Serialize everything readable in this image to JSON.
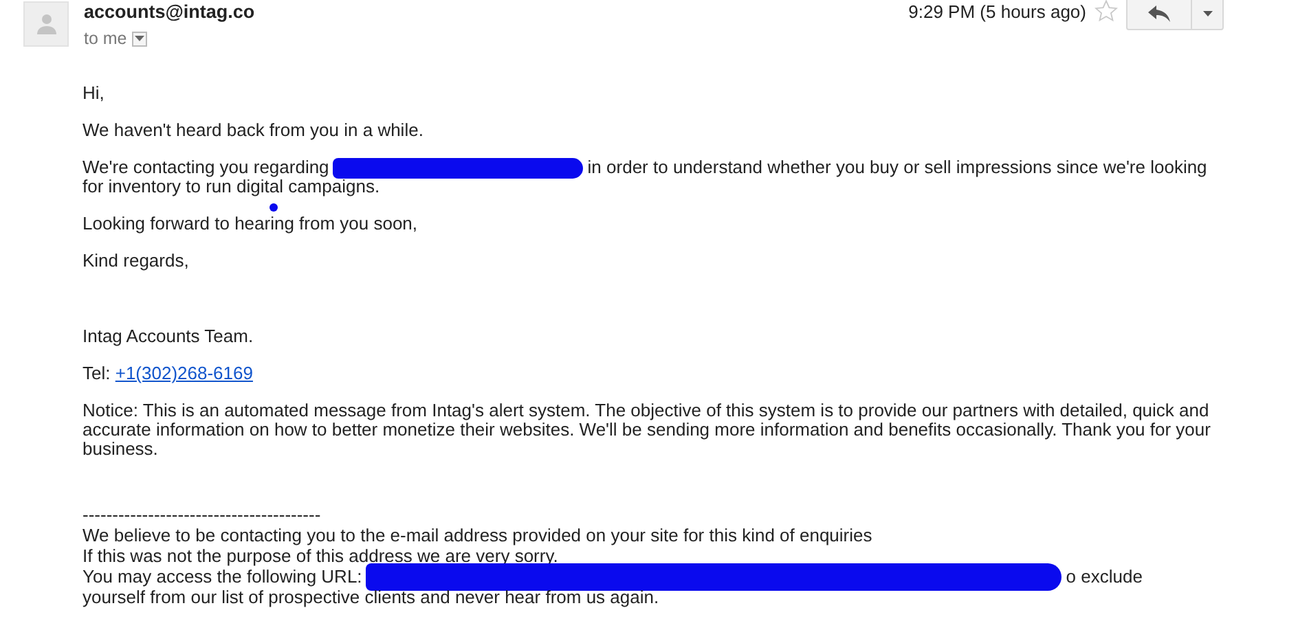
{
  "header": {
    "sender": "accounts@intag.co",
    "recipient": "to me",
    "time": "9:29 PM (5 hours ago)",
    "starred": false
  },
  "greeting": "Hi,",
  "paragraphs": [
    {
      "kind": "text",
      "text": "We haven't heard back from you in a while."
    },
    {
      "kind": "redacted",
      "before": "We're contacting you regarding",
      "after": "in order to understand whether you buy or sell impressions since we're looking",
      "continuation": "for inventory to run digital campaigns."
    },
    {
      "kind": "text",
      "text": "Looking forward to hearing from you soon,"
    },
    {
      "kind": "text",
      "text": "Kind regards,"
    }
  ],
  "signature": {
    "team": "Intag Accounts Team.",
    "tel_label": "Tel:",
    "tel": "+1(302)268-6169"
  },
  "notice": "Notice: This is an automated message from Intag's alert system. The objective of this system is to provide our partners with detailed, quick and accurate information on how to better monetize their websites. We'll be sending more information and benefits occasionally. Thank you for your business.",
  "footer": {
    "rule": "----------------------------------------",
    "lines": [
      {
        "kind": "text",
        "text": "We believe to be contacting you to the e-mail address provided on your site for this kind of enquiries"
      },
      {
        "kind": "text",
        "text": "If this was not the purpose of this address we are very sorry."
      },
      {
        "kind": "redacted",
        "before": "You may access the following URL:",
        "after": "o exclude"
      },
      {
        "kind": "text",
        "text": "yourself from our list of prospective clients and never hear from us again."
      }
    ]
  }
}
